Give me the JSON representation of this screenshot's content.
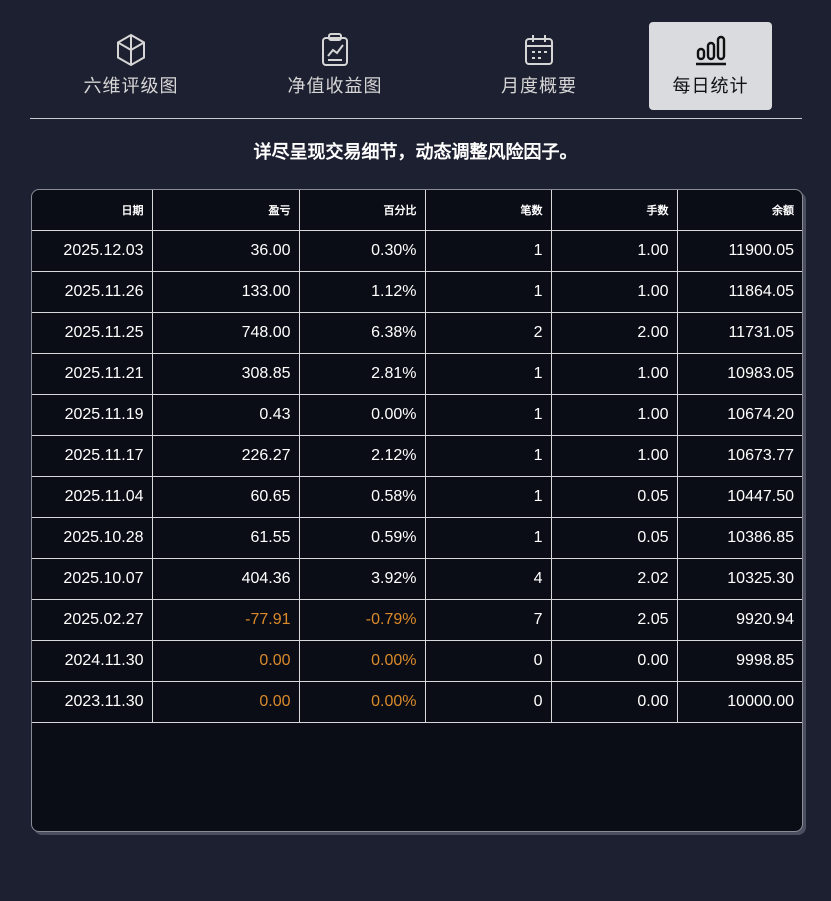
{
  "tabs": [
    {
      "label": "六维评级图",
      "icon": "hexagon-cube-icon",
      "active": false
    },
    {
      "label": "净值收益图",
      "icon": "trend-chart-icon",
      "active": false
    },
    {
      "label": "月度概要",
      "icon": "calendar-icon",
      "active": false
    },
    {
      "label": "每日统计",
      "icon": "bar-chart-icon",
      "active": true
    }
  ],
  "subtitle": "详尽呈现交易细节，动态调整风险因子。",
  "table": {
    "headers": [
      "日期",
      "盈亏",
      "百分比",
      "笔数",
      "手数",
      "余额"
    ],
    "rows": [
      [
        "2025.12.03",
        "36.00",
        "0.30%",
        "1",
        "1.00",
        "11900.05"
      ],
      [
        "2025.11.26",
        "133.00",
        "1.12%",
        "1",
        "1.00",
        "11864.05"
      ],
      [
        "2025.11.25",
        "748.00",
        "6.38%",
        "2",
        "2.00",
        "11731.05"
      ],
      [
        "2025.11.21",
        "308.85",
        "2.81%",
        "1",
        "1.00",
        "10983.05"
      ],
      [
        "2025.11.19",
        "0.43",
        "0.00%",
        "1",
        "1.00",
        "10674.20"
      ],
      [
        "2025.11.17",
        "226.27",
        "2.12%",
        "1",
        "1.00",
        "10673.77"
      ],
      [
        "2025.11.04",
        "60.65",
        "0.58%",
        "1",
        "0.05",
        "10447.50"
      ],
      [
        "2025.10.28",
        "61.55",
        "0.59%",
        "1",
        "0.05",
        "10386.85"
      ],
      [
        "2025.10.07",
        "404.36",
        "3.92%",
        "4",
        "2.02",
        "10325.30"
      ],
      [
        "2025.02.27",
        "-77.91",
        "-0.79%",
        "7",
        "2.05",
        "9920.94"
      ],
      [
        "2024.11.30",
        "0.00",
        "0.00%",
        "0",
        "0.00",
        "9998.85"
      ],
      [
        "2023.11.30",
        "0.00",
        "0.00%",
        "0",
        "0.00",
        "10000.00"
      ]
    ],
    "highlight_rows": [
      9,
      10,
      11
    ]
  },
  "colors": {
    "background": "#1c2030",
    "table_bg": "#0b0d16",
    "active_tab": "#d9dbdf",
    "highlight": "#d98a2a"
  }
}
